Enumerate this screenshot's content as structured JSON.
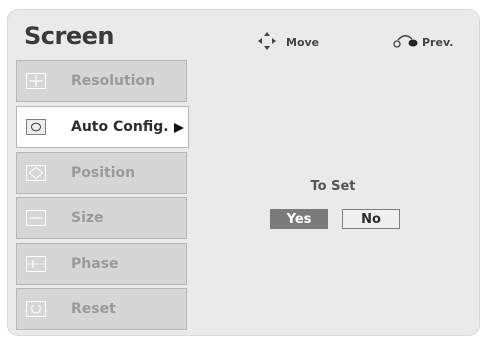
{
  "header": {
    "title": "Screen",
    "move_hint": "Move",
    "prev_hint": "Prev."
  },
  "menu": {
    "items": [
      {
        "label": "Resolution",
        "icon": "resolution-icon",
        "active": false
      },
      {
        "label": "Auto Config.",
        "icon": "auto-config-icon",
        "active": true
      },
      {
        "label": "Position",
        "icon": "position-icon",
        "active": false
      },
      {
        "label": "Size",
        "icon": "size-icon",
        "active": false
      },
      {
        "label": "Phase",
        "icon": "phase-icon",
        "active": false
      },
      {
        "label": "Reset",
        "icon": "reset-icon",
        "active": false
      }
    ]
  },
  "dialog": {
    "prompt": "To Set",
    "yes_label": "Yes",
    "no_label": "No",
    "selected": "Yes"
  },
  "colors": {
    "panel_bg": "#eaeaea",
    "item_bg": "#d6d6d6",
    "active_bg": "#ffffff",
    "yes_bg": "#7b7b7b"
  }
}
